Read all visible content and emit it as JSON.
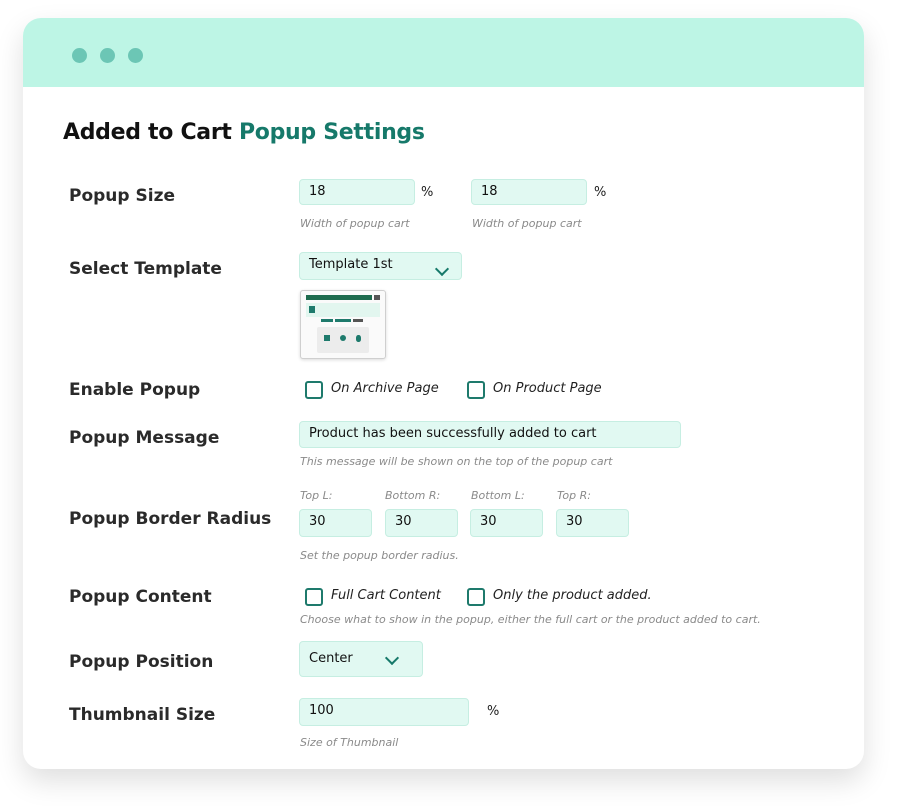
{
  "window": {
    "controls": [
      "dot",
      "dot",
      "dot"
    ]
  },
  "heading": {
    "prefix": "Added to Cart",
    "accent": "Popup Settings"
  },
  "colors": {
    "accent": "#16796a",
    "titlebar": "#bdf5e5",
    "input_bg": "#e1f9f2"
  },
  "popup_size": {
    "label": "Popup Size",
    "width": {
      "value": "18",
      "unit": "%",
      "hint": "Width of popup cart"
    },
    "height": {
      "value": "18",
      "unit": "%",
      "hint": "Width of popup cart"
    }
  },
  "select_template": {
    "label": "Select Template",
    "selected": "Template 1st",
    "preview_alt": "template-preview"
  },
  "enable_popup": {
    "label": "Enable Popup",
    "options": [
      {
        "label": "On Archive Page",
        "checked": false
      },
      {
        "label": "On Product Page",
        "checked": false
      }
    ]
  },
  "popup_message": {
    "label": "Popup Message",
    "value": "Product has been successfully added to cart",
    "hint": "This message will be shown on the top of the popup cart"
  },
  "border_radius": {
    "label": "Popup Border Radius",
    "fields": [
      {
        "label": "Top L:",
        "value": "30"
      },
      {
        "label": "Bottom R:",
        "value": "30"
      },
      {
        "label": "Bottom L:",
        "value": "30"
      },
      {
        "label": "Top R:",
        "value": "30"
      }
    ],
    "hint": "Set the popup border radius."
  },
  "popup_content": {
    "label": "Popup Content",
    "options": [
      {
        "label": "Full Cart Content",
        "checked": false
      },
      {
        "label": "Only the product added.",
        "checked": false
      }
    ],
    "hint": "Choose what to show in the popup, either the full cart or the product added to cart."
  },
  "popup_position": {
    "label": "Popup Position",
    "selected": "Center"
  },
  "thumbnail_size": {
    "label": "Thumbnail Size",
    "value": "100",
    "unit": "%",
    "hint": "Size of Thumbnail"
  }
}
